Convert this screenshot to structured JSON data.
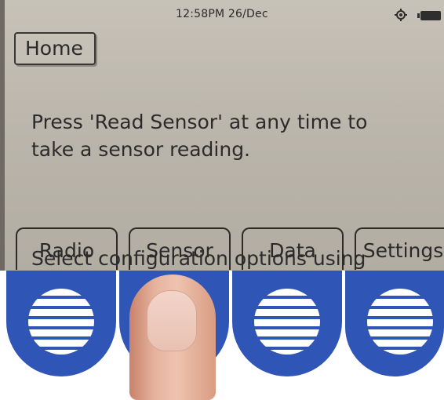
{
  "status": {
    "time_date": "12:58PM 26/Dec",
    "gps_icon": "gps-icon",
    "battery_icon": "battery-icon"
  },
  "home_tab": {
    "label": "Home"
  },
  "message": {
    "line1": "Press 'Read Sensor' at any time to\ntake a sensor reading.",
    "line2": "Select configuration options using\nthe softkeys below."
  },
  "softkeys": [
    {
      "label": "Radio"
    },
    {
      "label": "Sensor"
    },
    {
      "label": "Data"
    },
    {
      "label": "Settings"
    }
  ],
  "colors": {
    "key_blue": "#2f55b6",
    "screen_gray": "#bdb8ad"
  }
}
